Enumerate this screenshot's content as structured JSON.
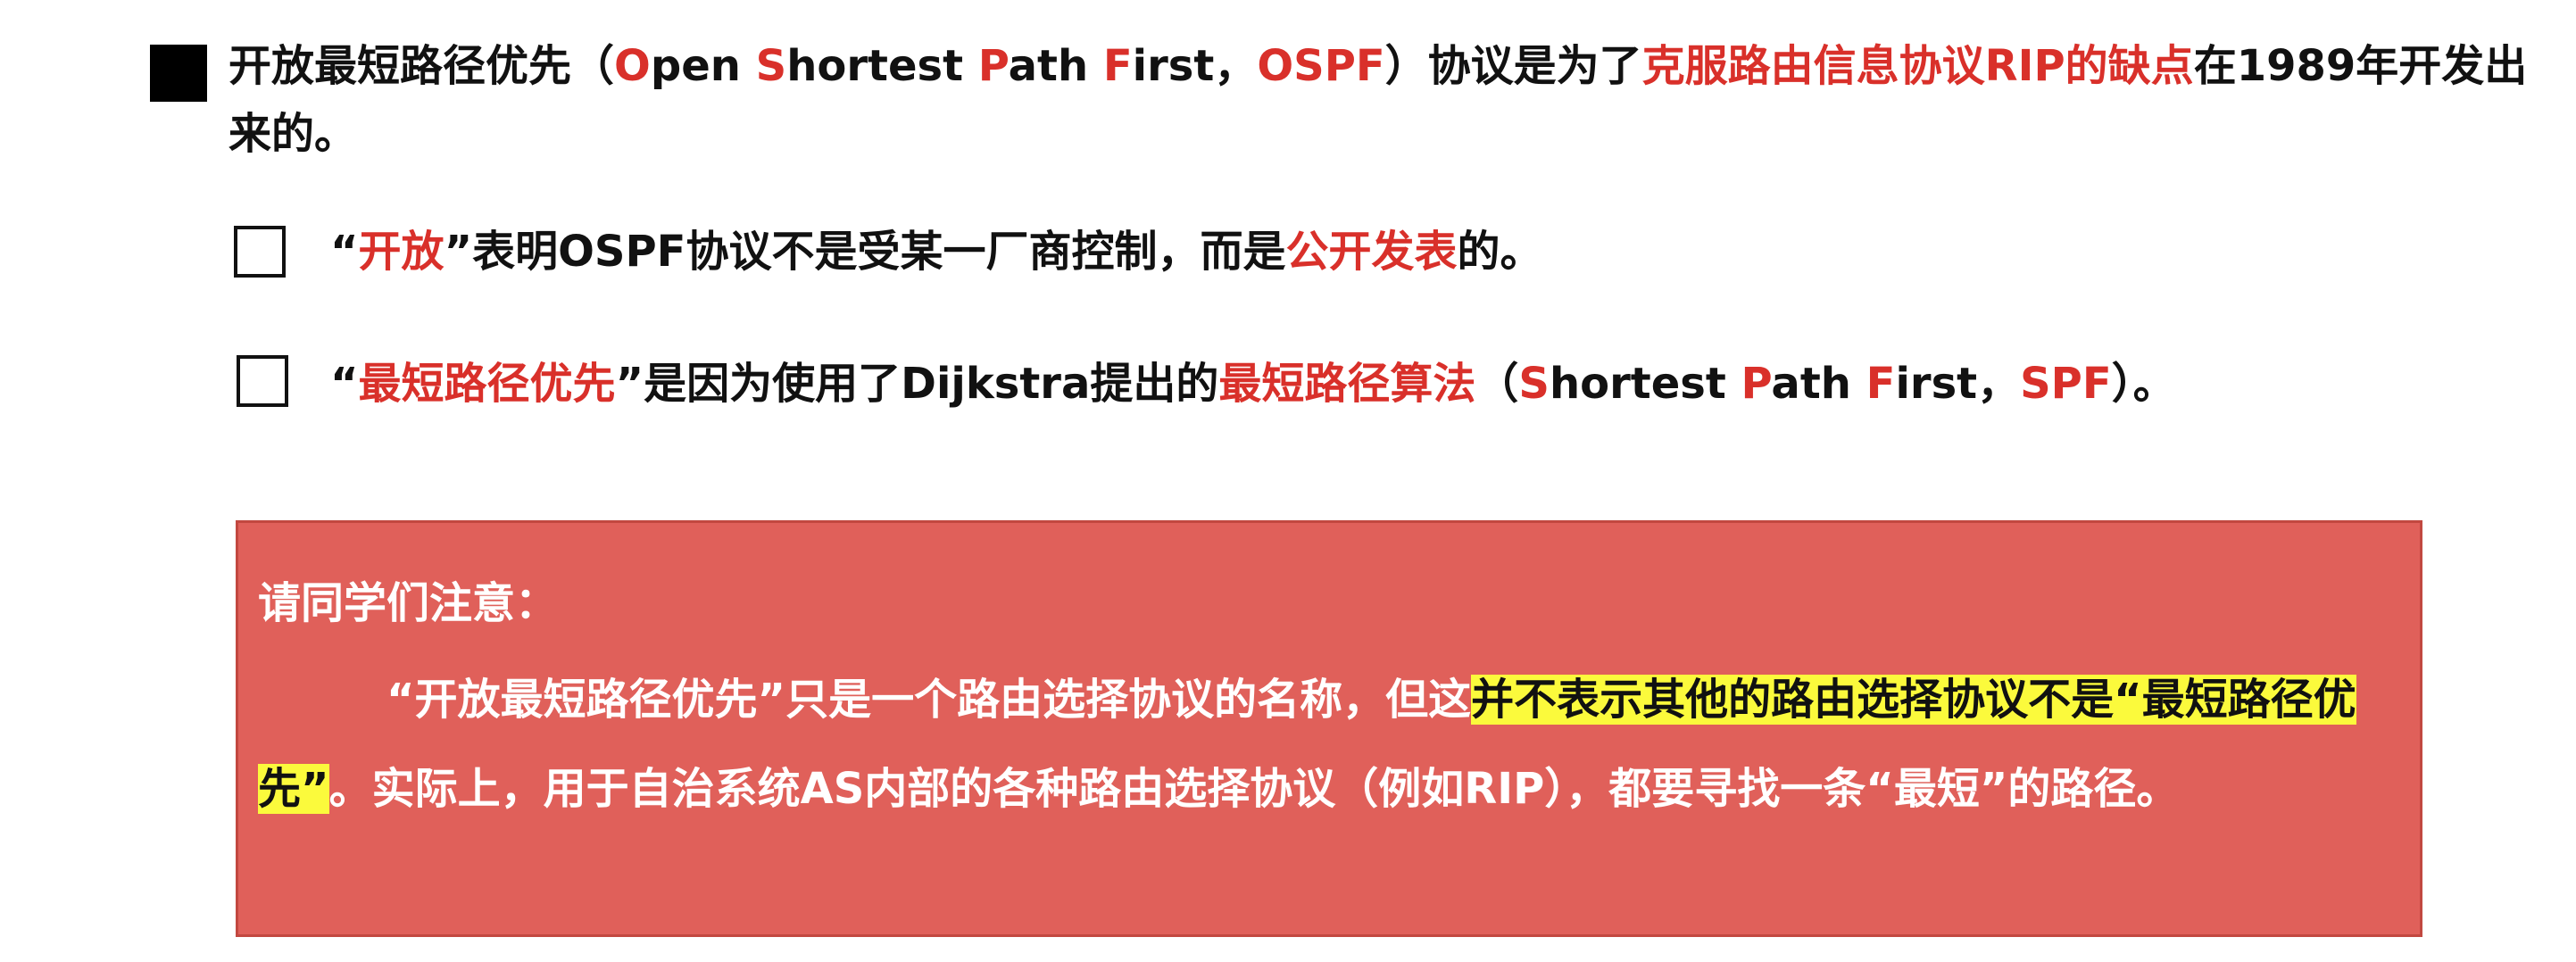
{
  "main": {
    "t1": "开放最短路径优先（",
    "o": "O",
    "pen": "pen ",
    "s": "S",
    "hortest": "hortest ",
    "p": "P",
    "ath": "ath ",
    "f": "F",
    "irst": "irst，",
    "ospf": "OSPF",
    "t2": "）协议是为了",
    "red": "克服路由信息协议RIP的缺点",
    "t3": "在1989年开发出来的。"
  },
  "sub1": {
    "q1": "“",
    "red": "开放",
    "q2": "”表明OSPF协议不是受某一厂商控制，而是",
    "red2": "公开发表",
    "t": "的。"
  },
  "sub2": {
    "q1": "“",
    "red": "最短路径优先",
    "q2": "”是因为使用了Dijkstra提出的",
    "red2": "最短路径算法",
    "t1": "（",
    "s": "S",
    "hortest": "hortest ",
    "p": "P",
    "ath": "ath ",
    "f": "F",
    "irst": "irst，",
    "spf": "SPF",
    "t2": "）。"
  },
  "note": {
    "title": "请同学们注意：",
    "p1": "“开放最短路径优先”只是一个路由选择协议的名称，但这",
    "hl": "并不表示其他的路由选择协议不是“最短路径优先”",
    "p2": "。实际上，用于自治系统AS内部的各种路由选择协议（例如RIP），都要寻找一条“最短”的路径。",
    "bg_color": "#e0605a",
    "highlight_color": "#fbfa3c"
  }
}
